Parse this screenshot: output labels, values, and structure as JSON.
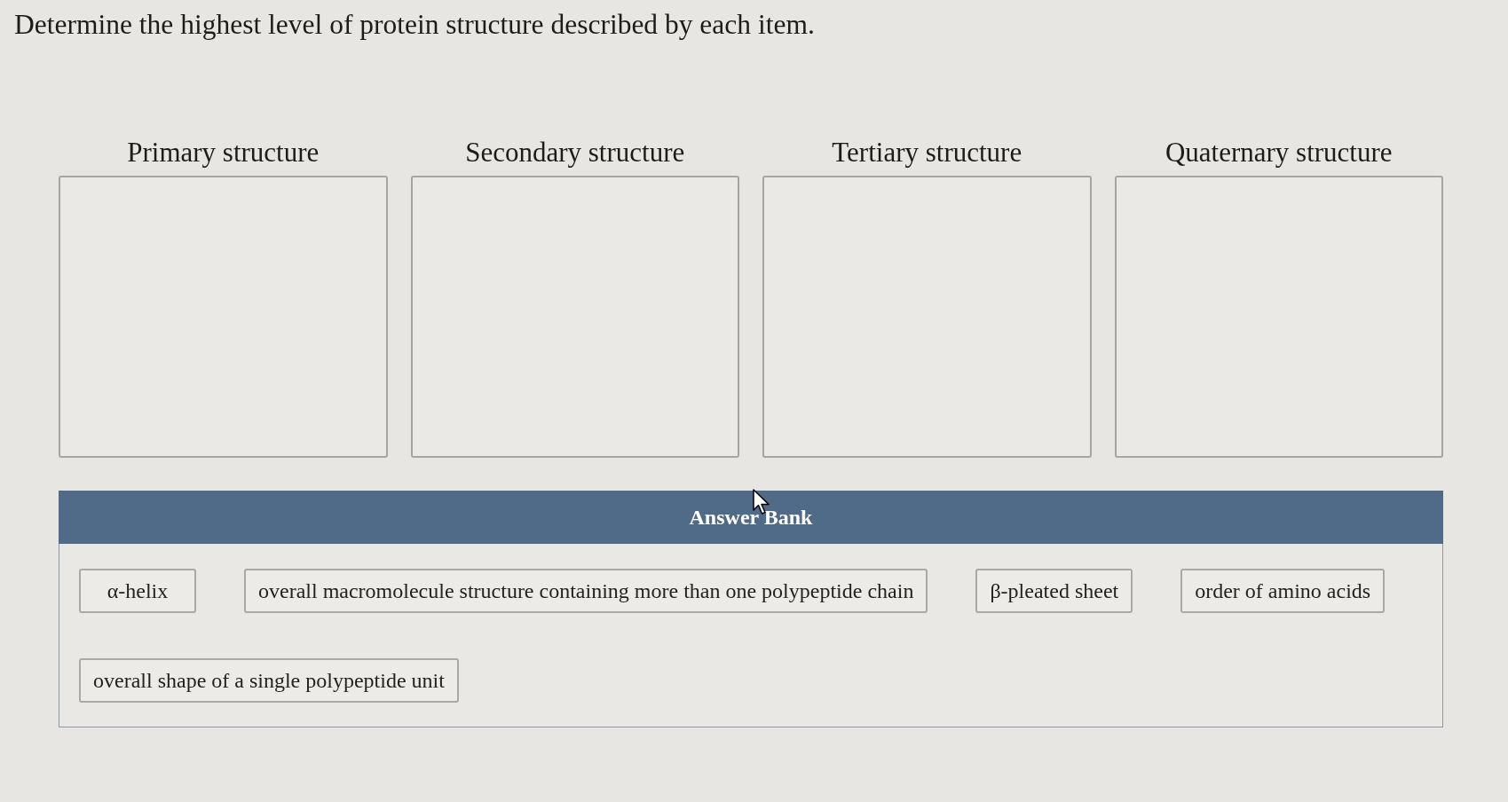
{
  "instruction": "Determine the highest level of protein structure described by each item.",
  "targets": [
    {
      "label": "Primary structure"
    },
    {
      "label": "Secondary structure"
    },
    {
      "label": "Tertiary structure"
    },
    {
      "label": "Quaternary structure"
    }
  ],
  "answer_bank": {
    "title": "Answer Bank",
    "items": [
      "α-helix",
      "overall macromolecule structure containing more than one polypeptide chain",
      "β-pleated sheet",
      "order of amino acids",
      "overall shape of a single polypeptide unit"
    ]
  }
}
